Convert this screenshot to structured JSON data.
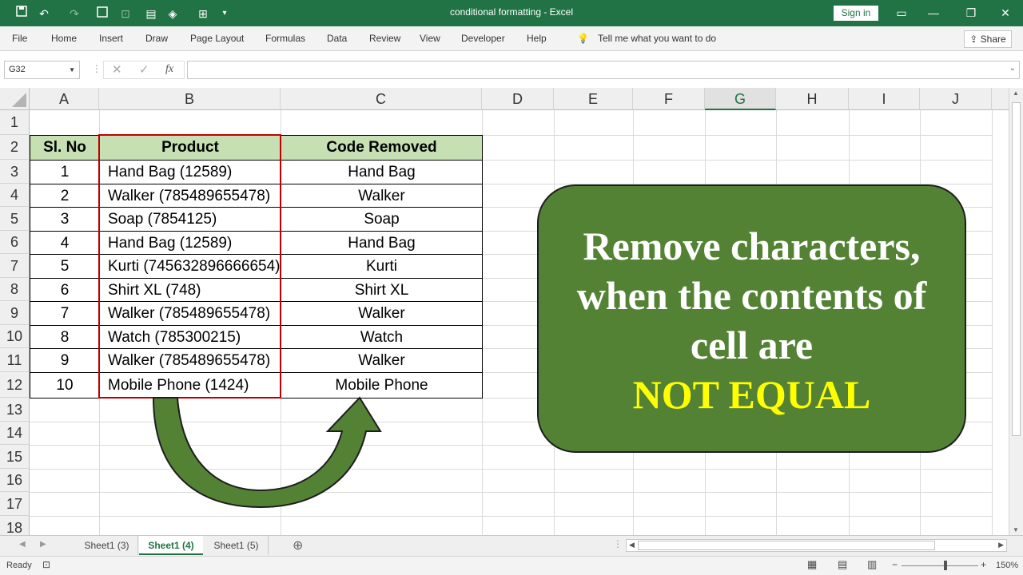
{
  "app": {
    "title": "conditional formatting  -  Excel",
    "sign_in": "Sign in",
    "share": "Share"
  },
  "menu": [
    "File",
    "Home",
    "Insert",
    "Draw",
    "Page Layout",
    "Formulas",
    "Data",
    "Review",
    "View",
    "Developer",
    "Help"
  ],
  "tell_me": "Tell me what you want to do",
  "formula_bar": {
    "name_box": "G32",
    "fx": "fx",
    "value": ""
  },
  "columns": [
    "A",
    "B",
    "C",
    "D",
    "E",
    "F",
    "G",
    "H",
    "I",
    "J"
  ],
  "selected_column": "G",
  "rows": [
    "1",
    "2",
    "3",
    "4",
    "5",
    "6",
    "7",
    "8",
    "9",
    "10",
    "11",
    "12",
    "13",
    "14",
    "15",
    "16",
    "17",
    "18"
  ],
  "table": {
    "headers": [
      "Sl. No",
      "Product",
      "Code Removed"
    ],
    "rows": [
      [
        "1",
        "Hand Bag (12589)",
        "Hand Bag"
      ],
      [
        "2",
        "Walker (785489655478)",
        "Walker"
      ],
      [
        "3",
        "Soap (7854125)",
        "Soap"
      ],
      [
        "4",
        "Hand Bag (12589)",
        "Hand Bag"
      ],
      [
        "5",
        "Kurti (745632896666654)",
        "Kurti"
      ],
      [
        "6",
        "Shirt XL (748)",
        "Shirt XL"
      ],
      [
        "7",
        "Walker (785489655478)",
        "Walker"
      ],
      [
        "8",
        "Watch (785300215)",
        "Watch"
      ],
      [
        "9",
        "Walker (785489655478)",
        "Walker"
      ],
      [
        "10",
        "Mobile Phone (1424)",
        "Mobile Phone"
      ]
    ]
  },
  "callout": {
    "line1": "Remove characters,",
    "line2": "when the contents of",
    "line3": "cell are",
    "line4": "NOT EQUAL",
    "bg_color": "#548235",
    "highlight_color": "#ffff00"
  },
  "sheets": [
    "Sheet1 (3)",
    "Sheet1 (4)",
    "Sheet1 (5)"
  ],
  "active_sheet": "Sheet1 (4)",
  "status": {
    "ready": "Ready",
    "zoom": "150%"
  },
  "colors": {
    "accent": "#217346",
    "header_fill": "#c6e0b4",
    "red_box": "#c00000"
  }
}
